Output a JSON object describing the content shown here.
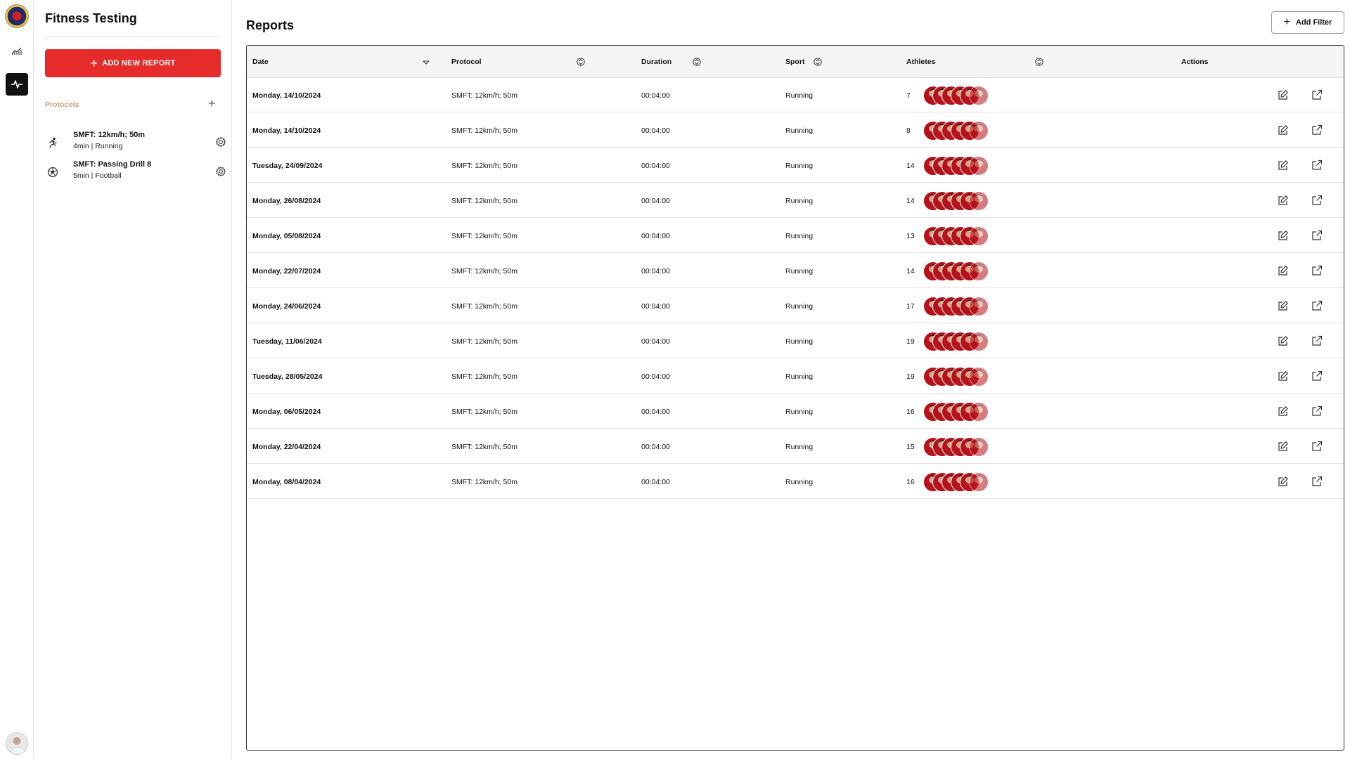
{
  "app": {
    "title": "Fitness Testing"
  },
  "sidebar": {
    "add_report_label": "ADD NEW REPORT",
    "protocols_label": "Protocols",
    "protocols": [
      {
        "name": "SMFT: 12km/h; 50m",
        "meta": "4min | Running",
        "icon": "running-icon"
      },
      {
        "name": "SMFT: Passing Drill 8",
        "meta": "5min | Football",
        "icon": "football-icon"
      }
    ]
  },
  "main": {
    "title": "Reports",
    "add_filter_label": "Add Filter",
    "columns": [
      "Date",
      "Protocol",
      "Duration",
      "Sport",
      "Athletes",
      "Actions"
    ],
    "rows": [
      {
        "date": "Monday, 14/10/2024",
        "protocol": "SMFT: 12km/h; 50m",
        "duration": "00:04:00",
        "sport": "Running",
        "athletes": "7"
      },
      {
        "date": "Monday, 14/10/2024",
        "protocol": "SMFT: 12km/h; 50m",
        "duration": "00:04:00",
        "sport": "Running",
        "athletes": "8"
      },
      {
        "date": "Tuesday, 24/09/2024",
        "protocol": "SMFT: 12km/h; 50m",
        "duration": "00:04:00",
        "sport": "Running",
        "athletes": "14"
      },
      {
        "date": "Monday, 26/08/2024",
        "protocol": "SMFT: 12km/h; 50m",
        "duration": "00:04:00",
        "sport": "Running",
        "athletes": "14"
      },
      {
        "date": "Monday, 05/08/2024",
        "protocol": "SMFT: 12km/h; 50m",
        "duration": "00:04:00",
        "sport": "Running",
        "athletes": "13"
      },
      {
        "date": "Monday, 22/07/2024",
        "protocol": "SMFT: 12km/h; 50m",
        "duration": "00:04:00",
        "sport": "Running",
        "athletes": "14"
      },
      {
        "date": "Monday, 24/06/2024",
        "protocol": "SMFT: 12km/h; 50m",
        "duration": "00:04:00",
        "sport": "Running",
        "athletes": "17"
      },
      {
        "date": "Tuesday, 11/06/2024",
        "protocol": "SMFT: 12km/h; 50m",
        "duration": "00:04:00",
        "sport": "Running",
        "athletes": "19"
      },
      {
        "date": "Tuesday, 28/05/2024",
        "protocol": "SMFT: 12km/h; 50m",
        "duration": "00:04:00",
        "sport": "Running",
        "athletes": "19"
      },
      {
        "date": "Monday, 06/05/2024",
        "protocol": "SMFT: 12km/h; 50m",
        "duration": "00:04:00",
        "sport": "Running",
        "athletes": "16"
      },
      {
        "date": "Monday, 22/04/2024",
        "protocol": "SMFT: 12km/h; 50m",
        "duration": "00:04:00",
        "sport": "Running",
        "athletes": "15"
      },
      {
        "date": "Monday, 08/04/2024",
        "protocol": "SMFT: 12km/h; 50m",
        "duration": "00:04:00",
        "sport": "Running",
        "athletes": "16"
      }
    ]
  },
  "colors": {
    "accent": "#e62b2b",
    "protocols_label": "#c9a27a",
    "rail_active": "#111111"
  }
}
